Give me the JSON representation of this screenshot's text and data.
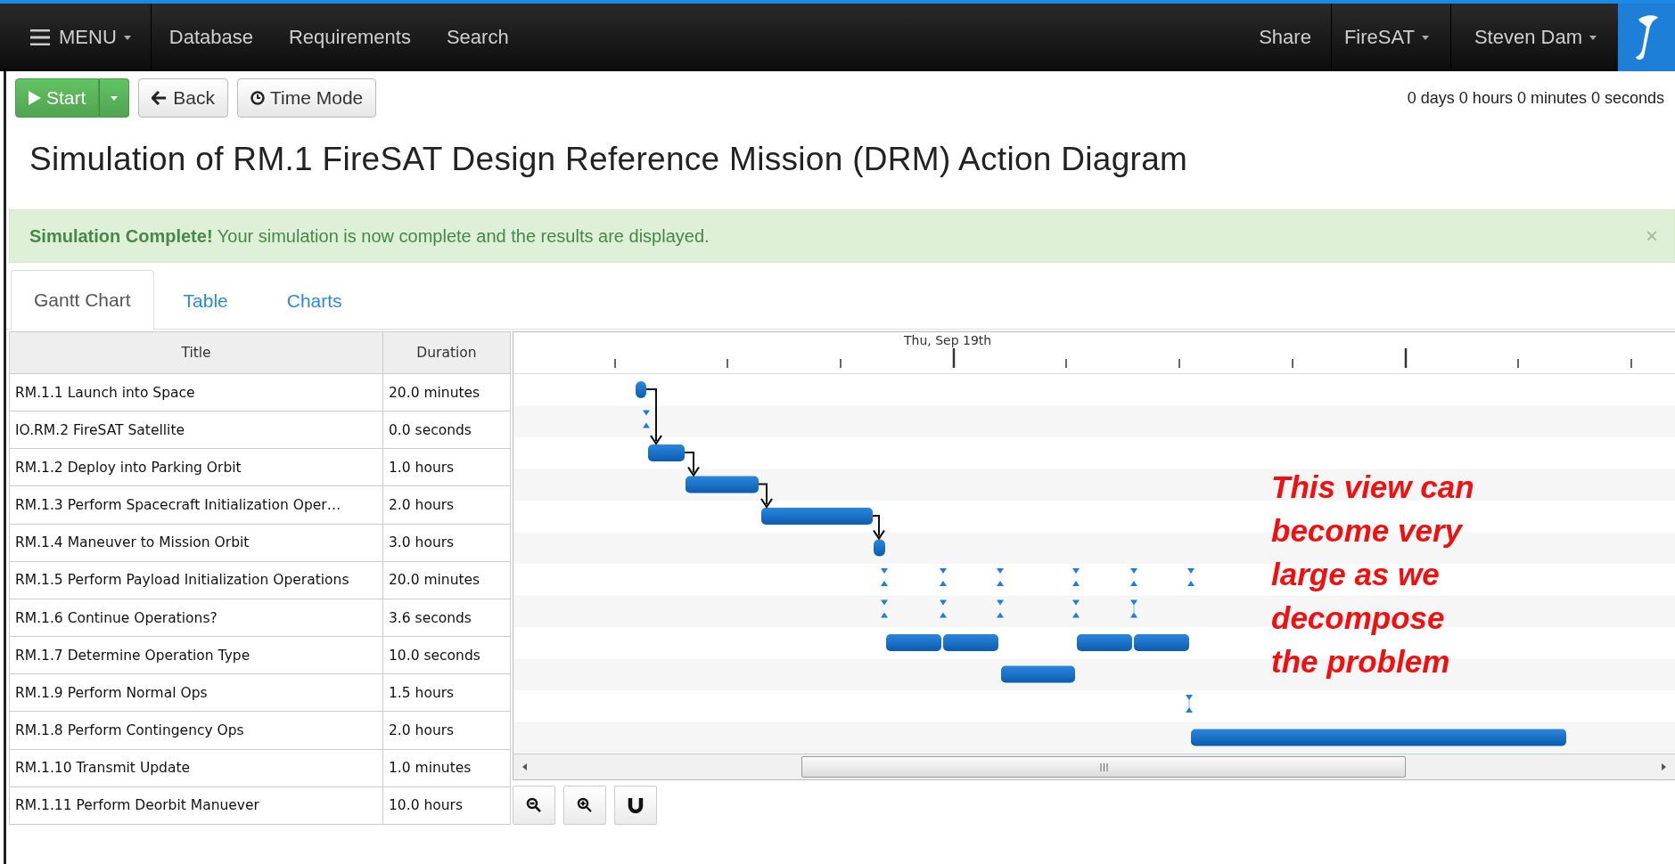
{
  "nav": {
    "menu": "MENU",
    "links": [
      "Database",
      "Requirements",
      "Search"
    ],
    "share": "Share",
    "project": "FireSAT",
    "user": "Steven Dam"
  },
  "toolbar": {
    "start": "Start",
    "back": "Back",
    "time_mode": "Time Mode",
    "elapsed": "0 days 0 hours 0 minutes 0 seconds"
  },
  "title": "Simulation of RM.1 FireSAT Design Reference Mission (DRM) Action Diagram",
  "alert": {
    "text": "**Simulation Complete!** Your simulation is now complete and the results are displayed.",
    "close": "×"
  },
  "tabs": [
    {
      "label": "Gantt Chart",
      "selected": true
    },
    {
      "label": "Table",
      "selected": false
    },
    {
      "label": "Charts",
      "selected": false
    }
  ],
  "table": {
    "columns": [
      "Title",
      "Duration"
    ],
    "rows": [
      {
        "title": "RM.1.1 Launch into Space",
        "duration": "20.0 minutes"
      },
      {
        "title": "IO.RM.2 FireSAT Satellite",
        "duration": "0.0 seconds"
      },
      {
        "title": "RM.1.2 Deploy into Parking Orbit",
        "duration": "1.0 hours"
      },
      {
        "title": "RM.1.3 Perform Spacecraft Initialization Oper…",
        "duration": "2.0 hours"
      },
      {
        "title": "RM.1.4 Maneuver to Mission Orbit",
        "duration": "3.0 hours"
      },
      {
        "title": "RM.1.5 Perform Payload Initialization Operations",
        "duration": "20.0 minutes"
      },
      {
        "title": "RM.1.6 Continue Operations?",
        "duration": "3.6 seconds"
      },
      {
        "title": "RM.1.7 Determine Operation Type",
        "duration": "10.0 seconds"
      },
      {
        "title": "RM.1.9 Perform Normal Ops",
        "duration": "1.5 hours"
      },
      {
        "title": "RM.1.8 Perform Contingency Ops",
        "duration": "2.0 hours"
      },
      {
        "title": "RM.1.10 Transmit Update",
        "duration": "1.0 minutes"
      },
      {
        "title": "RM.1.11 Perform Deorbit Manuever",
        "duration": "10.0 hours"
      }
    ]
  },
  "gantt": {
    "date_label": "Thu, Sep 19th"
  },
  "annotation": [
    "This view can",
    "become very",
    "large as we",
    "decompose",
    "the problem"
  ]
}
